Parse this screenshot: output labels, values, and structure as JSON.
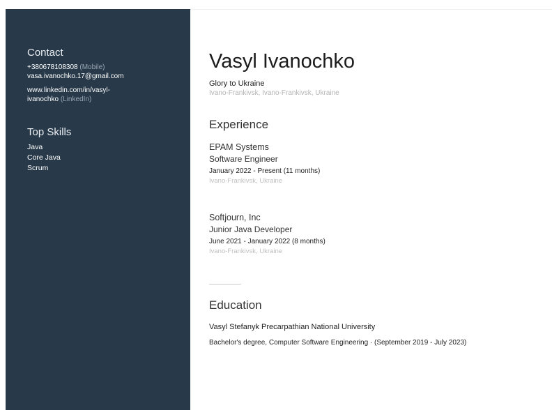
{
  "contact": {
    "title": "Contact",
    "phone": "+380678108308",
    "phone_type": "(Mobile)",
    "email": "vasa.ivanochko.17@gmail.com",
    "linkedin_line1": "www.linkedin.com/in/vasyl-",
    "linkedin_line2": "ivanochko",
    "linkedin_type": "(LinkedIn)"
  },
  "skills": {
    "title": "Top Skills",
    "items": [
      "Java",
      "Core Java",
      "Scrum"
    ]
  },
  "profile": {
    "name": "Vasyl Ivanochko",
    "headline": "Glory to Ukraine",
    "location": "Ivano-Frankivsk, Ivano-Frankivsk, Ukraine"
  },
  "experience": {
    "title": "Experience",
    "jobs": [
      {
        "company": "EPAM Systems",
        "role": "Software Engineer",
        "dates": "January 2022 - Present (11 months)",
        "location": "Ivano-Frankivsk, Ukraine"
      },
      {
        "company": "Softjourn, Inc",
        "role": "Junior Java Developer",
        "dates": "June 2021 - January 2022 (8 months)",
        "location": "Ivano-Frankivsk, Ukraine"
      }
    ]
  },
  "education": {
    "title": "Education",
    "school": "Vasyl Stefanyk Precarpathian National University",
    "degree": "Bachelor's degree, Computer Software Engineering · (September 2019 - July 2023)"
  }
}
